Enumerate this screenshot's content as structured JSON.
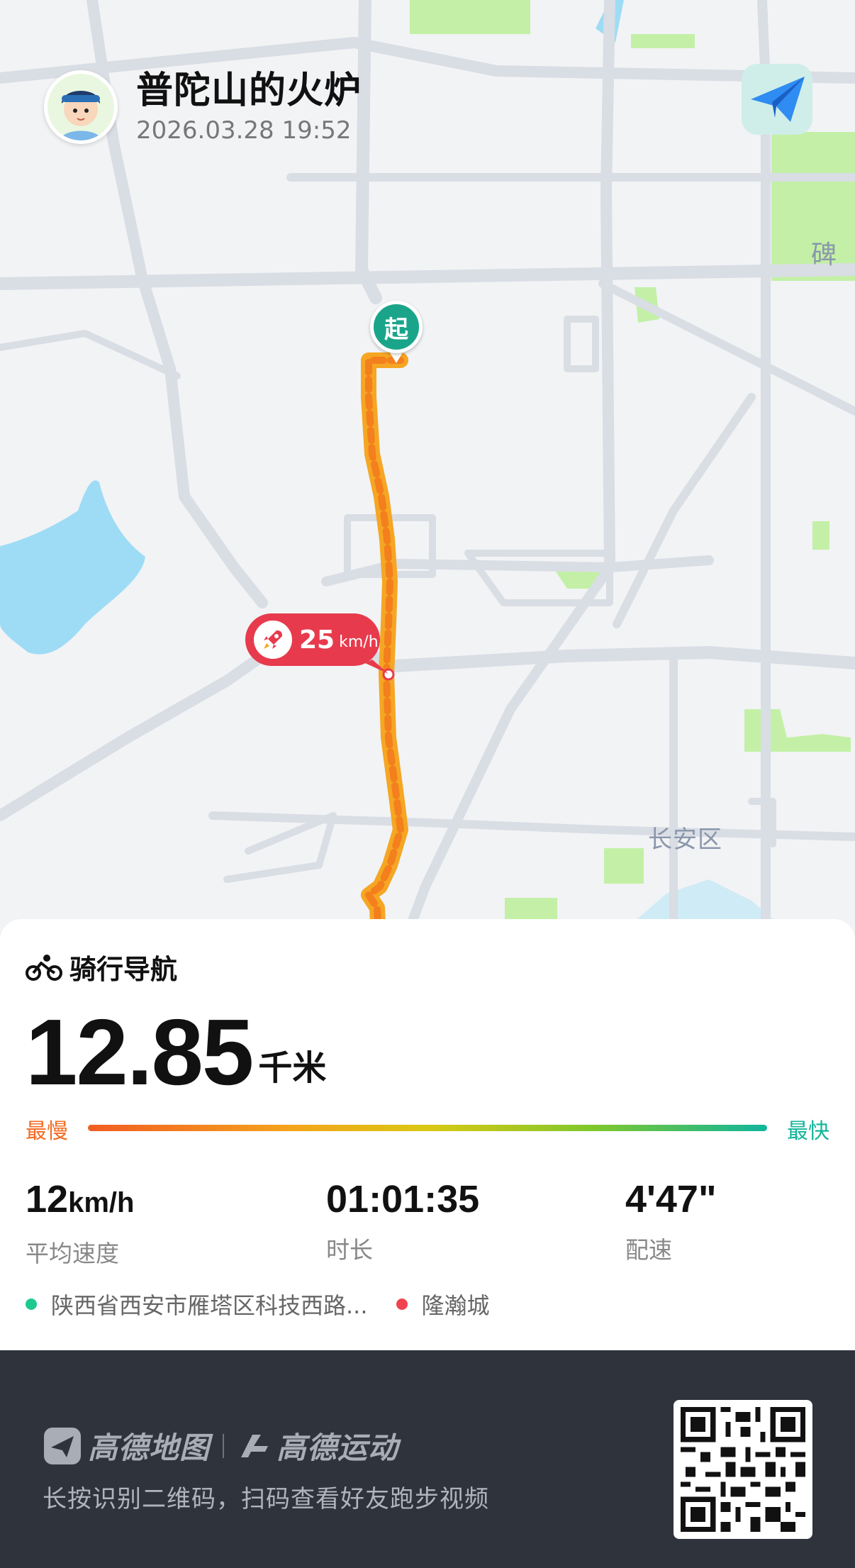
{
  "header": {
    "user_name": "普陀山的火炉",
    "timestamp": "2026.03.28 19:52",
    "avatar_icon": "avatar-boy-icon",
    "share_icon": "paper-plane-icon"
  },
  "map": {
    "start_marker": "起",
    "max_speed_value": "25",
    "max_speed_unit": "km/h",
    "max_speed_icon": "rocket-icon",
    "district_label": "长安区",
    "edge_label": "碑",
    "colors": {
      "route": "#f7931e",
      "water": "#9edcf6",
      "park": "#c3f0a6",
      "road": "#d9dde4"
    }
  },
  "summary": {
    "mode_icon": "bicycle-icon",
    "mode_label": "骑行导航",
    "distance_value": "12.85",
    "distance_unit": "千米",
    "scale_slow_label": "最慢",
    "scale_fast_label": "最快",
    "stats": [
      {
        "value": "12",
        "unit": "km/h",
        "label": "平均速度"
      },
      {
        "value": "01:01:35",
        "unit": "",
        "label": "时长"
      },
      {
        "value": "4'47\"",
        "unit": "",
        "label": "配速"
      }
    ],
    "start_location": "陕西省西安市雁塔区科技西路...",
    "end_location": "隆瀚城",
    "colors": {
      "slow": "#f36b22",
      "fast": "#13b59a",
      "start_dot": "#1ec98e",
      "end_dot": "#f0434f"
    }
  },
  "footer": {
    "brand_1": "高德地图",
    "brand_1_icon": "amap-logo-icon",
    "brand_2": "高德运动",
    "brand_2_icon": "amap-sport-logo-icon",
    "hint": "长按识别二维码，扫码查看好友跑步视频",
    "qr_icon": "qr-code-icon"
  }
}
